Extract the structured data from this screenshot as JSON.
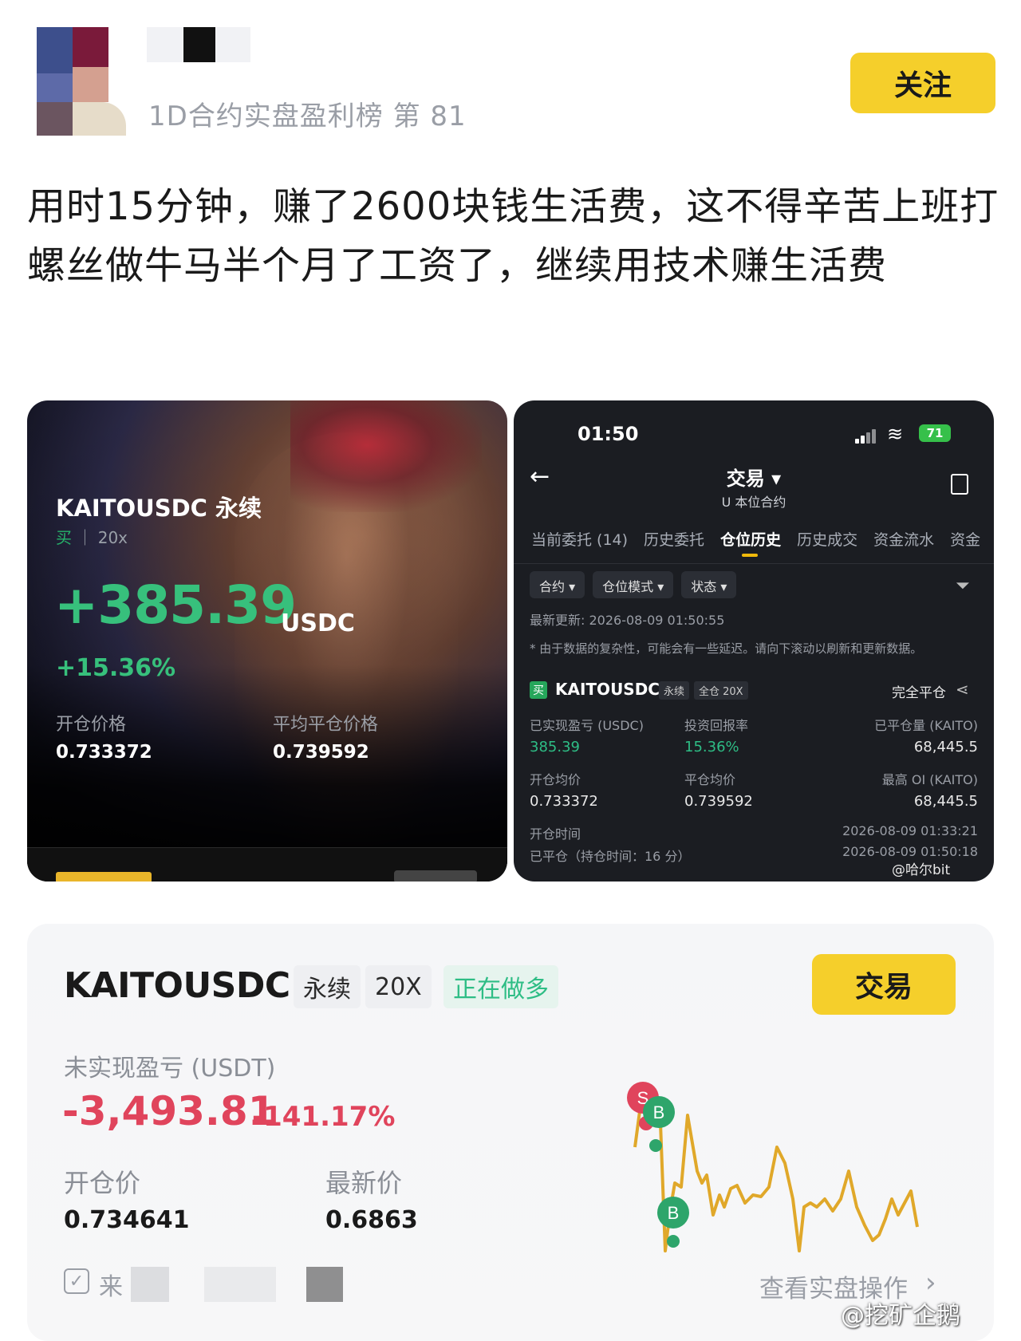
{
  "header": {
    "rank_text": "1D合约实盘盈利榜 第 81",
    "follow_label": "关注"
  },
  "post": {
    "text": "用时15分钟，赚了2600块钱生活费，这不得辛苦上班打螺丝做牛马半个月了工资了，继续用技术赚生活费"
  },
  "share_card": {
    "symbol_title": "KAITOUSDC 永续",
    "side": "买",
    "leverage": "20x",
    "pnl": "+385.39",
    "pnl_unit": "USDC",
    "pnl_pct": "+15.36%",
    "open_label": "开仓价格",
    "open_value": "0.733372",
    "close_label": "平均平仓价格",
    "close_value": "0.739592"
  },
  "app_screen": {
    "time": "01:50",
    "battery": "71",
    "title": "交易 ▾",
    "subtitle": "U 本位合约",
    "tabs": [
      "当前委托 (14)",
      "历史委托",
      "仓位历史",
      "历史成交",
      "资金流水",
      "资金"
    ],
    "active_tab": "仓位历史",
    "filters": [
      "合约 ▾",
      "仓位模式 ▾",
      "状态 ▾"
    ],
    "updated": "最新更新: 2026-08-09 01:50:55",
    "note": "* 由于数据的复杂性，可能会有一些延迟。请向下滚动以刷新和更新数据。",
    "buy_badge": "买",
    "symbol": "KAITOUSDC",
    "tag1": "永续",
    "tag2": "全仓 20X",
    "close_status": "完全平仓",
    "realized_label": "已实现盈亏 (USDC)",
    "realized_value": "385.39",
    "roi_label": "投资回报率",
    "roi_value": "15.36%",
    "closed_qty_label": "已平仓量 (KAITO)",
    "closed_qty_value": "68,445.5",
    "entry_label": "开仓均价",
    "entry_value": "0.733372",
    "exit_label": "平仓均价",
    "exit_value": "0.739592",
    "max_oi_label": "最高 OI (KAITO)",
    "max_oi_value": "68,445.5",
    "open_time_label": "开仓时间",
    "open_time_value": "2026-08-09 01:33:21",
    "closed_label": "已平仓（持仓时间：16 分）",
    "closed_time_value": "2026-08-09 01:50:18",
    "watermark": "@哈尔bit"
  },
  "position_card": {
    "symbol": "KAITOUSDC",
    "tag_perp": "永续",
    "tag_leverage": "20X",
    "tag_status": "正在做多",
    "trade_label": "交易",
    "upl_label": "未实现盈亏 (USDT)",
    "upl_value": "-3,493.81",
    "upl_pct": "-141.17%",
    "open_label": "开仓价",
    "open_value": "0.734641",
    "last_label": "最新价",
    "last_value": "0.6863",
    "source_prefix": "来",
    "view_label": "查看实盘操作"
  },
  "weibo_watermark": "@挖矿企鹅",
  "colors": {
    "accent_yellow": "#f5cf2b",
    "profit_green": "#37c07c",
    "loss_red": "#e0445c",
    "chart_line": "#e0a82a"
  }
}
